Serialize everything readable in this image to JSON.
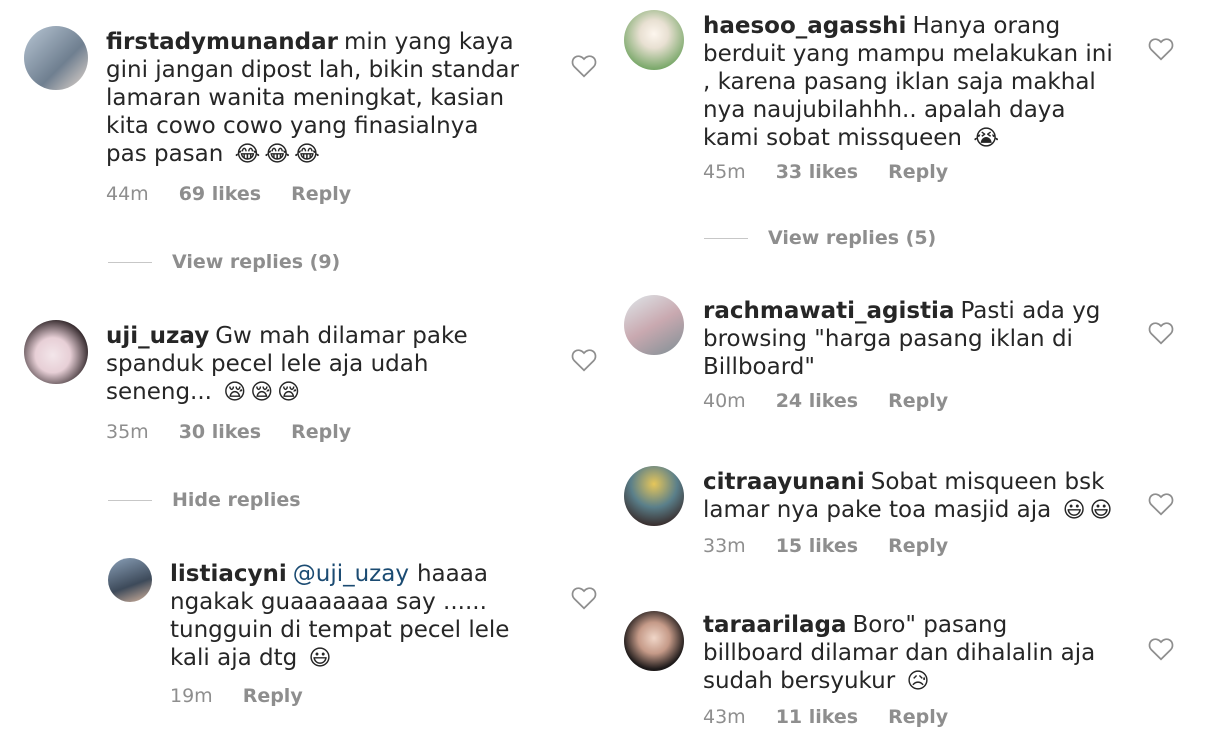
{
  "left_column": {
    "comments": [
      {
        "username": "firstadymunandar",
        "text": "min yang kaya gini jangan dipost lah,  bikin standar lamaran wanita meningkat, kasian kita cowo cowo yang finasialnya pas pasan",
        "emoji": "😂😂😂",
        "time": "44m",
        "likes": "69 likes",
        "reply": "Reply"
      },
      {
        "username": "uji_uzay",
        "text": "Gw mah dilamar pake spanduk pecel lele aja udah seneng...",
        "emoji": "😪😪😪",
        "time": "35m",
        "likes": "30 likes",
        "reply": "Reply"
      }
    ],
    "view_replies_1": "View replies (9)",
    "hide_replies": "Hide replies",
    "reply_comment": {
      "username": "listiacyni",
      "mention": "@uji_uzay",
      "text": "haaaa ngakak guaaaaaaa say ...... tungguin di tempat pecel lele kali aja dtg",
      "emoji": "😃",
      "time": "19m",
      "reply": "Reply"
    }
  },
  "right_column": {
    "comments": [
      {
        "username": "haesoo_agasshi",
        "text": "Hanya orang berduit yang mampu melakukan ini , karena pasang iklan saja makhal nya naujubilahhh.. apalah daya kami sobat missqueen",
        "emoji": "😭",
        "time": "45m",
        "likes": "33 likes",
        "reply": "Reply"
      },
      {
        "username": "rachmawati_agistia",
        "text": "Pasti ada yg browsing \"harga pasang iklan di Billboard\"",
        "emoji": "",
        "time": "40m",
        "likes": "24 likes",
        "reply": "Reply"
      },
      {
        "username": "citraayunani",
        "text": "Sobat misqueen bsk lamar nya pake toa masjid aja",
        "emoji": "😃😃",
        "time": "33m",
        "likes": "15 likes",
        "reply": "Reply"
      },
      {
        "username": "taraarilaga",
        "text": "Boro\" pasang billboard dilamar dan dihalalin aja sudah bersyukur",
        "emoji": "😥",
        "time": "43m",
        "likes": "11 likes",
        "reply": "Reply"
      }
    ],
    "view_replies": "View replies (5)"
  },
  "icons": {
    "like": "heart-icon"
  },
  "colors": {
    "text": "#262626",
    "meta": "#8e8e8e",
    "mention": "#1b4b72"
  }
}
